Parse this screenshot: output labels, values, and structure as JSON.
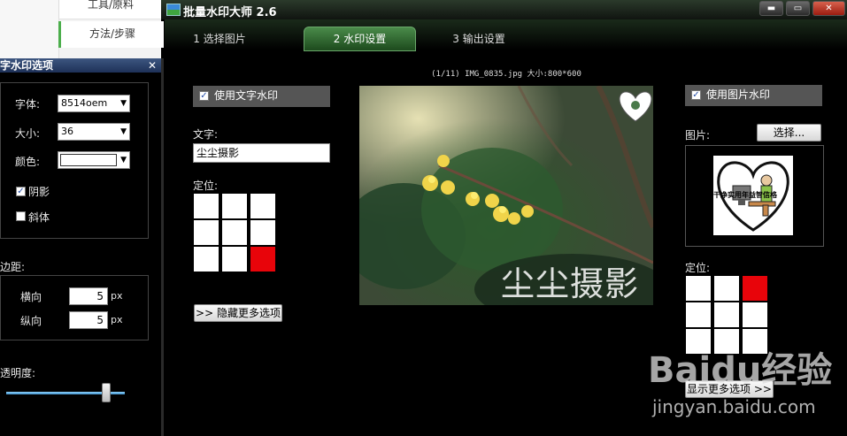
{
  "web": {
    "tab1": "工具/原料",
    "tab2": "方法/步骤"
  },
  "left_panel": {
    "title": "字水印选项",
    "font_label": "字体:",
    "font_value": "8514oem",
    "size_label": "大小:",
    "size_value": "36",
    "color_label": "颜色:",
    "color_value": "#ffffff",
    "shadow_label": "阴影",
    "shadow_checked": true,
    "italic_label": "斜体",
    "italic_checked": false,
    "margin_label": "边距:",
    "horizontal_label": "横向",
    "horizontal_value": "5",
    "vertical_label": "纵向",
    "vertical_value": "5",
    "unit": "px",
    "opacity_label": "透明度:",
    "opacity_level": 0.84
  },
  "window": {
    "title": "批量水印大师 2.6",
    "min": "▬",
    "max": "▭",
    "close": "✕"
  },
  "tabs": [
    {
      "label": "1  选择图片",
      "active": false
    },
    {
      "label": "2  水印设置",
      "active": true
    },
    {
      "label": "3  输出设置",
      "active": false
    }
  ],
  "info": "(1/11)  IMG_0835.jpg  大小:800*600",
  "text_wm": {
    "enable_label": "使用文字水印",
    "enabled": true,
    "text_label": "文字:",
    "text_value": "尘尘摄影",
    "position_label": "定位:",
    "selected_cell": 8,
    "toggle_button": ">> 隐藏更多选项"
  },
  "preview": {
    "watermark_text": "尘尘摄影"
  },
  "image_wm": {
    "enable_label": "使用图片水印",
    "enabled": true,
    "picture_label": "图片:",
    "choose_button": "选择...",
    "position_label": "定位:",
    "selected_cell": 2,
    "toggle_button": "显示更多选项 >>",
    "picture_text": "干净实用年益智信格"
  },
  "overlay": {
    "site_logo": "Baidu经验",
    "site_url": "jingyan.baidu.com"
  }
}
